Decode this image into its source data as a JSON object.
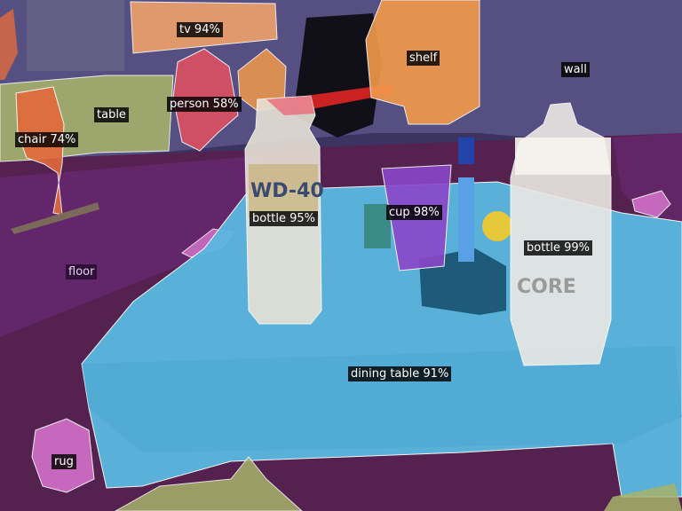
{
  "segments": [
    {
      "id": "tv",
      "label": "tv 94%",
      "color": "#f3a46b"
    },
    {
      "id": "shelf",
      "label": "shelf",
      "color": "#f39a4a"
    },
    {
      "id": "wall",
      "label": "wall",
      "color": "#6a5f8f"
    },
    {
      "id": "table",
      "label": "table",
      "color": "#a7b36a"
    },
    {
      "id": "person",
      "label": "person 58%",
      "color": "#e05060"
    },
    {
      "id": "chair",
      "label": "chair 74%",
      "color": "#e26a3c"
    },
    {
      "id": "bottle_left",
      "label": "bottle 95%",
      "color": "#f2f2f2"
    },
    {
      "id": "cup",
      "label": "cup 98%",
      "color": "#8a46c8"
    },
    {
      "id": "bottle_right",
      "label": "bottle 99%",
      "color": "#f2f2f2"
    },
    {
      "id": "floor",
      "label": "floor",
      "color": "#6b2a78"
    },
    {
      "id": "dining_table",
      "label": "dining table 91%",
      "color": "#5ab8e0"
    },
    {
      "id": "rug",
      "label": "rug",
      "color": "#d070c8"
    }
  ],
  "product_text": {
    "can_brand": "WD-40",
    "bottle_brand": "CORE"
  }
}
